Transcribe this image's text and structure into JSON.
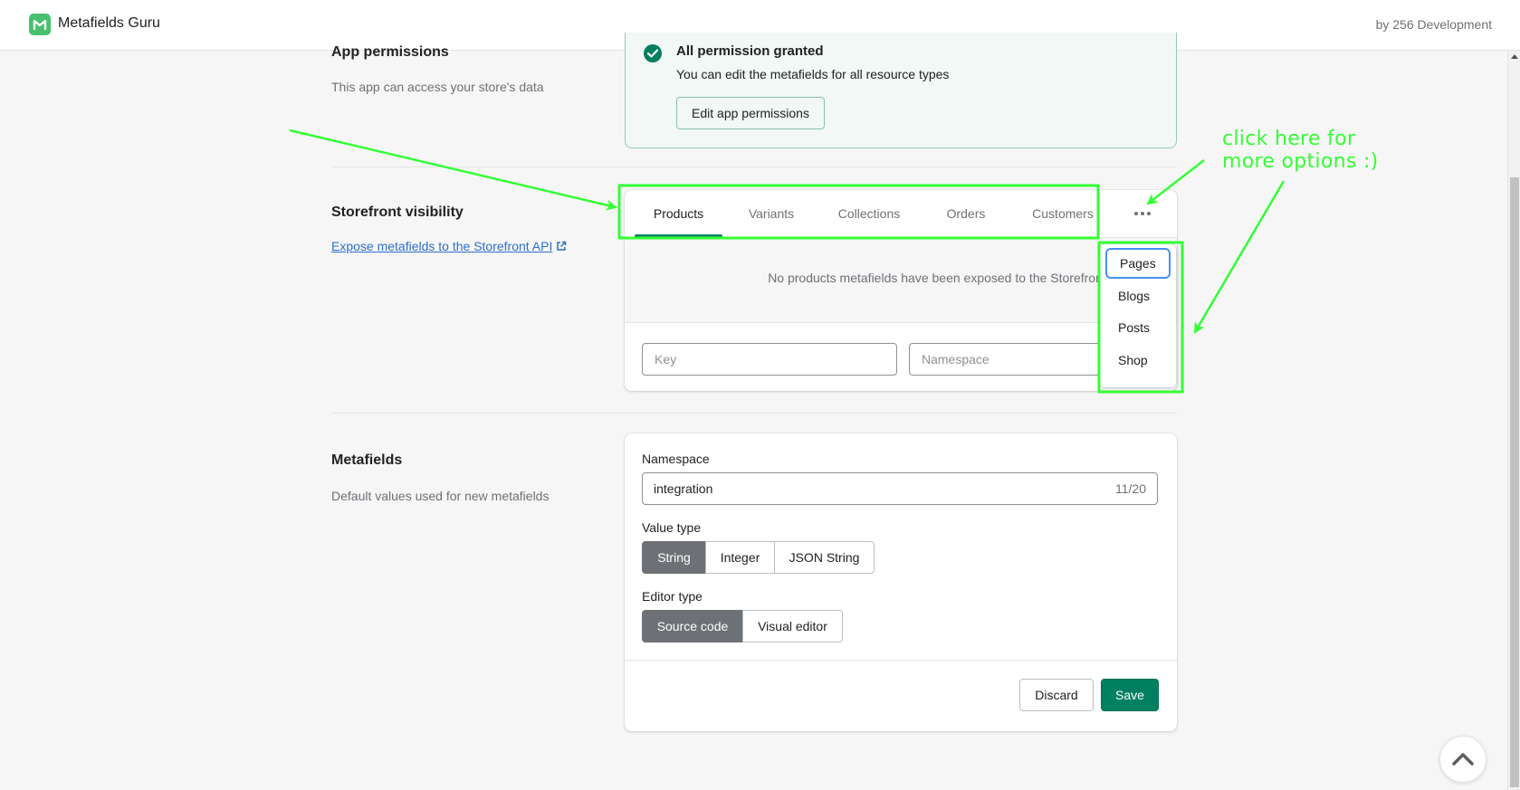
{
  "header": {
    "app_name": "Metafields Guru",
    "developer": "by 256 Development",
    "logo_icon": "metafields-guru-logo"
  },
  "permissions": {
    "title": "App permissions",
    "description": "This app can access your store's data",
    "status_title": "All permission granted",
    "status_text": "You can edit the metafields for all resource types",
    "edit_button": "Edit app permissions"
  },
  "storefront": {
    "title": "Storefront visibility",
    "link": "Expose metafields to the Storefront API",
    "tabs": [
      "Products",
      "Variants",
      "Collections",
      "Orders",
      "Customers"
    ],
    "active_tab": "Products",
    "more_icon": "ellipsis-horizontal-icon",
    "empty_message": "No products metafields have been exposed to the Storefront API yet",
    "key_placeholder": "Key",
    "namespace_placeholder": "Namespace",
    "more_options": [
      "Pages",
      "Blogs",
      "Posts",
      "Shop"
    ]
  },
  "metafields": {
    "title": "Metafields",
    "description": "Default values used for new metafields",
    "namespace_label": "Namespace",
    "namespace_value": "integration",
    "namespace_count": "11/20",
    "value_type_label": "Value type",
    "value_types": [
      "String",
      "Integer",
      "JSON String"
    ],
    "value_type_selected": "String",
    "editor_type_label": "Editor type",
    "editor_types": [
      "Source code",
      "Visual editor"
    ],
    "editor_type_selected": "Source code",
    "discard_label": "Discard",
    "save_label": "Save"
  },
  "annotation": {
    "line1": "click here for",
    "line2": "more options :)",
    "color": "#33ff33"
  },
  "colors": {
    "accent": "#008060",
    "link": "#2c6ecb",
    "selected_segment": "#6d7175"
  }
}
